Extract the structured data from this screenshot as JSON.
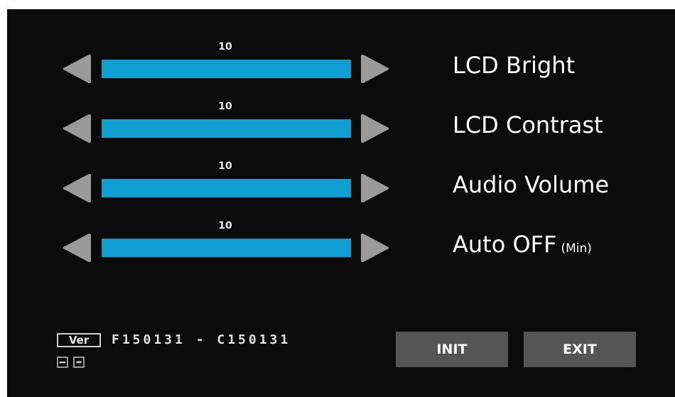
{
  "settings": [
    {
      "label": "LCD Bright",
      "value": "10",
      "level": 1.0
    },
    {
      "label": "LCD Contrast",
      "value": "10",
      "level": 1.0
    },
    {
      "label": "Audio Volume",
      "value": "10",
      "level": 1.0
    },
    {
      "label": "Auto OFF",
      "unit": "(Min)",
      "value": "10",
      "level": 1.0
    }
  ],
  "version": {
    "tag": "Ver",
    "text": "F150131 - C150131",
    "icons": [
      "lcd-board-icon",
      "firmware-icon"
    ]
  },
  "buttons": {
    "init": "INIT",
    "exit": "EXIT"
  },
  "icons": {
    "decrease": "left-triangle-icon",
    "increase": "right-triangle-icon"
  },
  "colors": {
    "background": "#0b0b0b",
    "bar_fill": "#0f9fd3",
    "arrow": "#9a9a9a",
    "button": "#555555",
    "text": "#ffffff"
  }
}
